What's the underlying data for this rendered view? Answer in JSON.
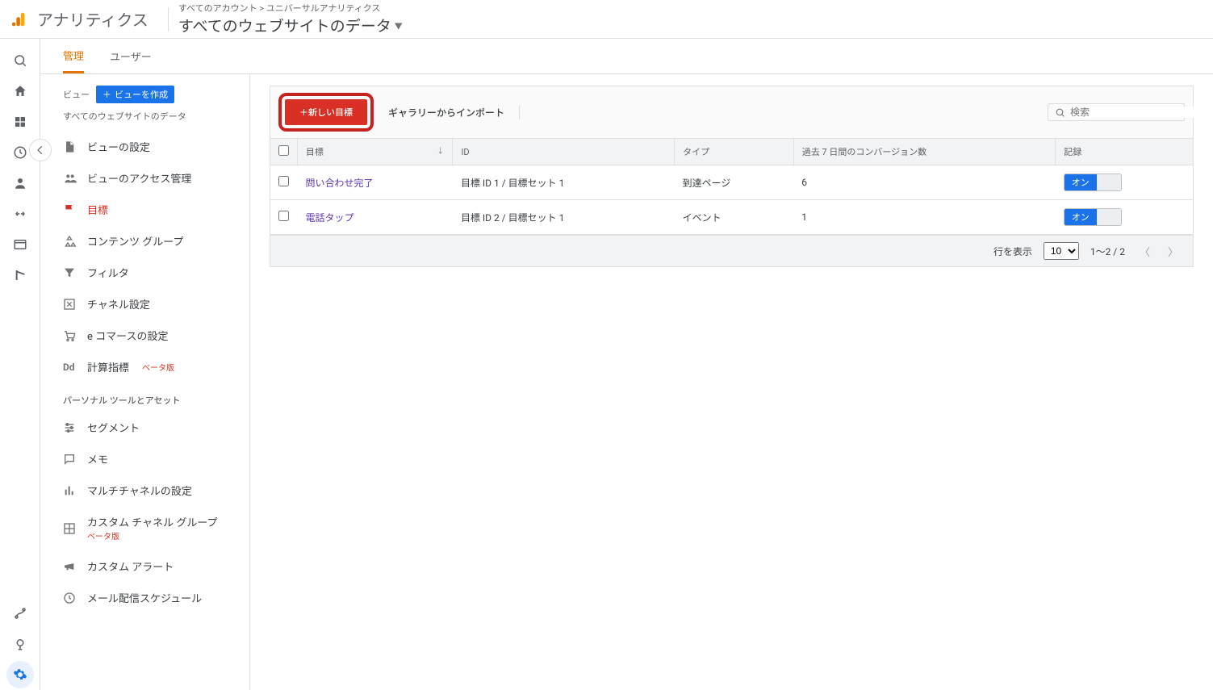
{
  "header": {
    "app_name": "アナリティクス",
    "breadcrumb": "すべてのアカウント > ユニバーサルアナリティクス",
    "view_title": "すべてのウェブサイトのデータ"
  },
  "tabs": {
    "admin": "管理",
    "user": "ユーザー"
  },
  "view_column": {
    "label": "ビュー",
    "create_button": "ビューを作成",
    "subtitle": "すべてのウェブサイトのデータ",
    "items": {
      "settings": "ビューの設定",
      "access": "ビューのアクセス管理",
      "goals": "目標",
      "content_groups": "コンテンツ グループ",
      "filters": "フィルタ",
      "channel_settings": "チャネル設定",
      "ecommerce": "e コマースの設定",
      "calc_metrics": "計算指標",
      "calc_metrics_beta": "ベータ版",
      "section_personal": "パーソナル ツールとアセット",
      "segments": "セグメント",
      "notes": "メモ",
      "multichannel": "マルチチャネルの設定",
      "custom_channel_group": "カスタム チャネル グループ",
      "custom_channel_group_beta": "ベータ版",
      "custom_alerts": "カスタム アラート",
      "mail_schedule": "メール配信スケジュール"
    }
  },
  "goals_panel": {
    "new_goal_button": "＋新しい目標",
    "import_link": "ギャラリーからインポート",
    "search_placeholder": "検索",
    "columns": {
      "goal": "目標",
      "id": "ID",
      "type": "タイプ",
      "conversions7d": "過去 7 日間のコンバージョン数",
      "recording": "記録"
    },
    "rows": [
      {
        "name": "問い合わせ完了",
        "id": "目標 ID 1 / 目標セット 1",
        "type": "到達ページ",
        "conv": "6",
        "toggle": "オン"
      },
      {
        "name": "電話タップ",
        "id": "目標 ID 2 / 目標セット 1",
        "type": "イベント",
        "conv": "1",
        "toggle": "オン"
      }
    ],
    "pager": {
      "rows_label": "行を表示",
      "page_size": "10",
      "range": "1～2 / 2"
    }
  }
}
